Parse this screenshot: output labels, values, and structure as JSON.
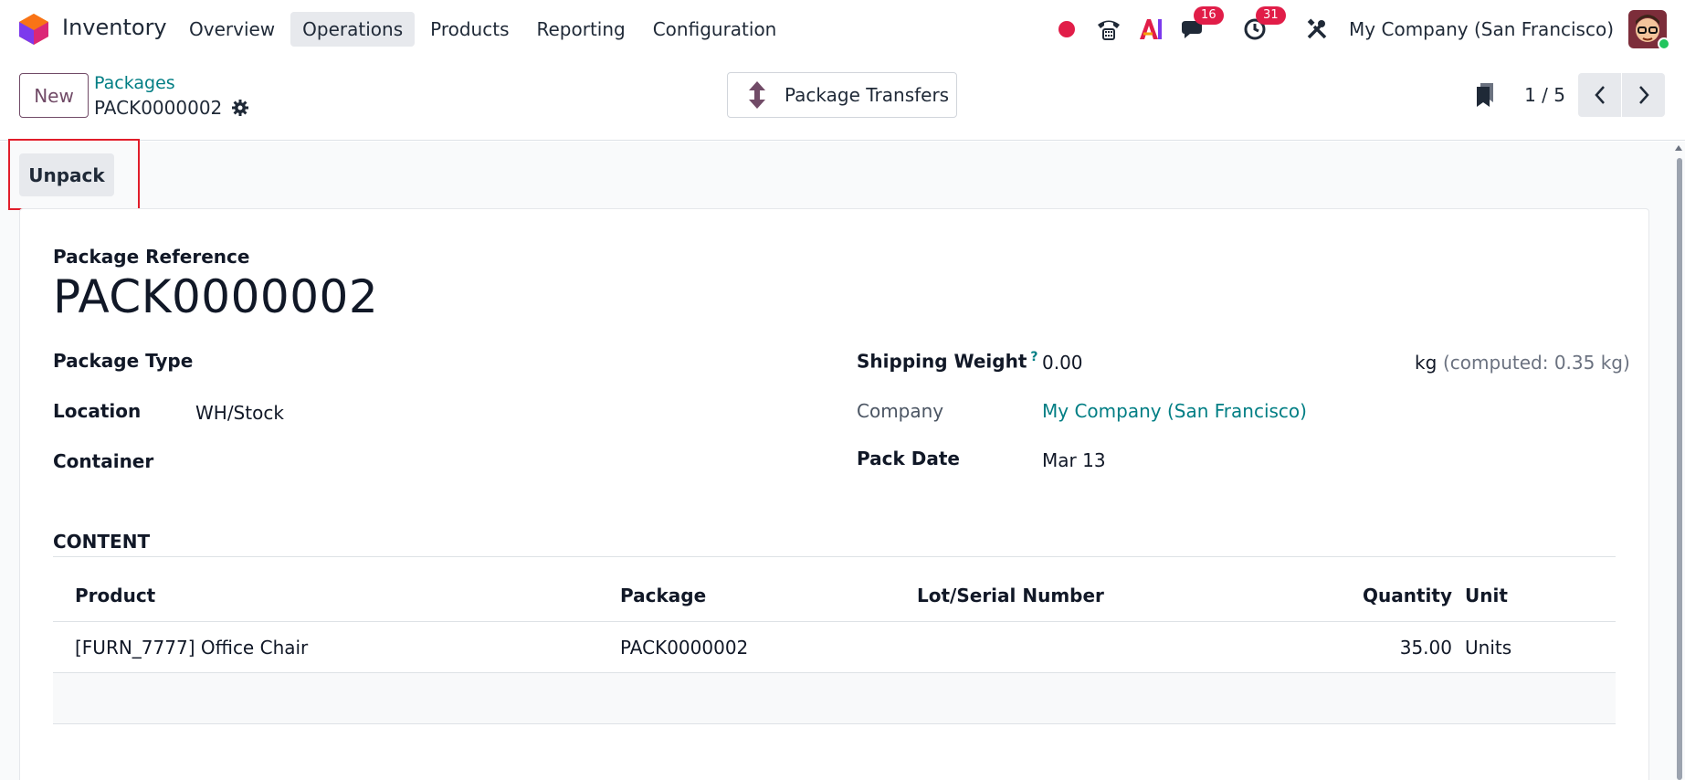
{
  "navbar": {
    "app_name": "Inventory",
    "menu": [
      {
        "label": "Overview"
      },
      {
        "label": "Operations",
        "active": true
      },
      {
        "label": "Products"
      },
      {
        "label": "Reporting"
      },
      {
        "label": "Configuration"
      }
    ],
    "messages_count": "16",
    "activities_count": "31",
    "company": "My Company (San Francisco)",
    "icons": [
      "record-dot-icon",
      "phone-icon",
      "ai-icon",
      "chat-icon",
      "clock-icon",
      "tools-icon"
    ]
  },
  "control_panel": {
    "new_label": "New",
    "breadcrumb": "Packages",
    "record_name": "PACK0000002",
    "smart_button": "Package Transfers",
    "pager": "1 / 5"
  },
  "actions": {
    "unpack_label": "Unpack"
  },
  "form": {
    "reference_label": "Package Reference",
    "reference_value": "PACK0000002",
    "package_type_label": "Package Type",
    "package_type_value": "",
    "location_label": "Location",
    "location_value": "WH/Stock",
    "container_label": "Container",
    "container_value": "",
    "shipping_weight_label": "Shipping Weight",
    "shipping_weight_help": "?",
    "shipping_weight_value": "0.00",
    "weight_unit": "kg",
    "computed_weight": "(computed: 0.35 kg)",
    "company_label": "Company",
    "company_value": "My Company (San Francisco)",
    "pack_date_label": "Pack Date",
    "pack_date_value": "Mar 13"
  },
  "content": {
    "title": "CONTENT",
    "columns": {
      "product": "Product",
      "package": "Package",
      "lot": "Lot/Serial Number",
      "quantity": "Quantity",
      "unit": "Unit"
    },
    "rows": [
      {
        "product": "[FURN_7777] Office Chair",
        "package": "PACK0000002",
        "lot": "",
        "quantity": "35.00",
        "unit": "Units"
      }
    ]
  },
  "colors": {
    "brand": "#714b67",
    "link": "#017e84",
    "badge": "#e11d48",
    "highlight_box": "#e11d2a"
  }
}
